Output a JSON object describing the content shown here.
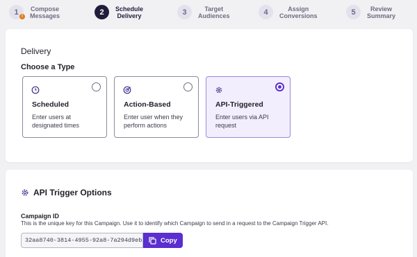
{
  "stepper": {
    "steps": [
      {
        "number": "1",
        "line1": "Compose",
        "line2": "Messages",
        "warning": "!"
      },
      {
        "number": "2",
        "line1": "Schedule",
        "line2": "Delivery"
      },
      {
        "number": "3",
        "line1": "Target",
        "line2": "Audiences"
      },
      {
        "number": "4",
        "line1": "Assign",
        "line2": "Conversions"
      },
      {
        "number": "5",
        "line1": "Review",
        "line2": "Summary"
      }
    ],
    "active_step": 2
  },
  "delivery": {
    "title": "Delivery",
    "choose_label": "Choose a Type",
    "types": [
      {
        "icon": "clock-icon",
        "title": "Scheduled",
        "description": "Enter users at designated times",
        "selected": false
      },
      {
        "icon": "target-icon",
        "title": "Action-Based",
        "description": "Enter user when they perform actions",
        "selected": false
      },
      {
        "icon": "gear-icon",
        "title": "API-Triggered",
        "description": "Enter users via API request",
        "selected": true
      }
    ]
  },
  "api_trigger": {
    "title": "API Trigger Options",
    "campaign_id_label": "Campaign ID",
    "campaign_id_help": "This is the unique key for this Campaign. Use it to identify which Campaign to send in a request to the Campaign Trigger API.",
    "campaign_id_value": "32aa8740-3814-4955-92a8-7a294d9eb…",
    "copy_label": "Copy"
  },
  "colors": {
    "accent": "#5b2ecf",
    "active_step": "#221d3a",
    "selected_tile_bg": "#f3eefd",
    "warning": "#e07a1f"
  }
}
